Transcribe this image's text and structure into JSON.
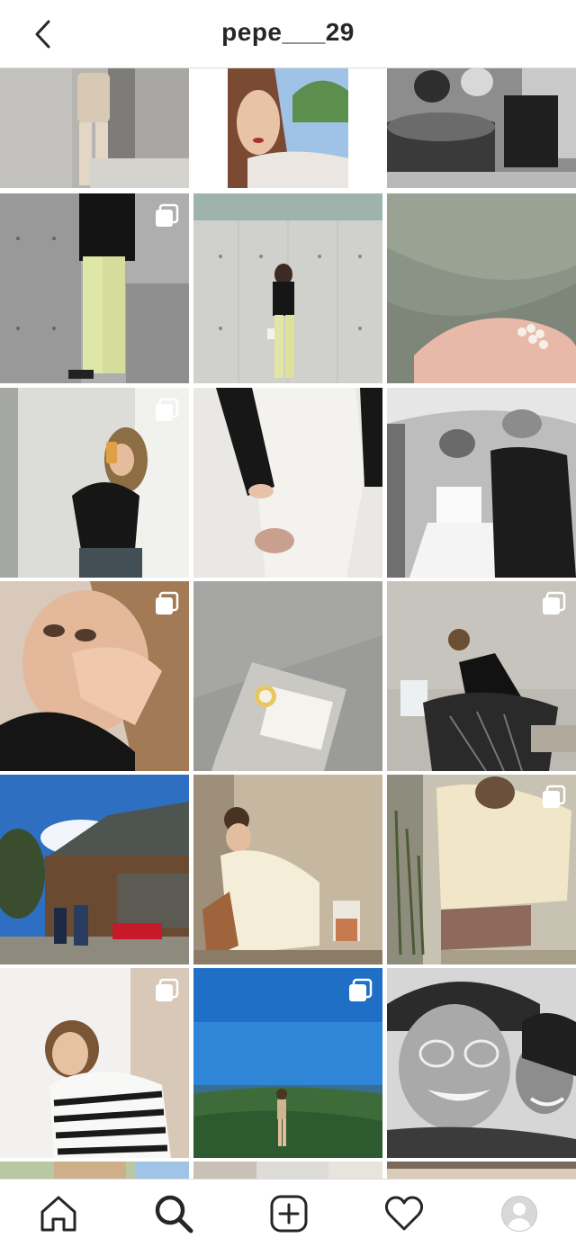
{
  "header": {
    "username": "pepe___29",
    "back_icon": "chevron-left-icon"
  },
  "grid": {
    "posts": [
      {
        "scene": "concrete-wall-beige-outfit",
        "bw": false,
        "multi": false
      },
      {
        "scene": "selfie-palm-tree",
        "bw": false,
        "multi": false
      },
      {
        "scene": "bw-grill-dinner",
        "bw": true,
        "multi": false
      },
      {
        "scene": "yellow-pants-wall",
        "bw": false,
        "multi": true
      },
      {
        "scene": "concrete-wall-standing",
        "bw": false,
        "multi": false
      },
      {
        "scene": "pearl-ring-hand",
        "bw": false,
        "multi": false
      },
      {
        "scene": "mirror-selfie-black-knit",
        "bw": false,
        "multi": true
      },
      {
        "scene": "ripped-white-jeans",
        "bw": false,
        "multi": false
      },
      {
        "scene": "bw-bridal-hairstyle",
        "bw": true,
        "multi": false
      },
      {
        "scene": "closeup-face-hand",
        "bw": false,
        "multi": true
      },
      {
        "scene": "pin-on-card",
        "bw": false,
        "multi": false
      },
      {
        "scene": "black-dress-pose",
        "bw": false,
        "multi": true
      },
      {
        "scene": "japanese-temple",
        "bw": false,
        "multi": false
      },
      {
        "scene": "sitting-cream-sweater",
        "bw": false,
        "multi": false
      },
      {
        "scene": "knit-shorts-outfit",
        "bw": false,
        "multi": true
      },
      {
        "scene": "striped-sweater",
        "bw": false,
        "multi": true
      },
      {
        "scene": "coast-view-sky",
        "bw": false,
        "multi": true
      },
      {
        "scene": "bw-friends-selfie",
        "bw": true,
        "multi": false
      },
      {
        "scene": "partial-1",
        "bw": false,
        "multi": false
      },
      {
        "scene": "partial-2",
        "bw": false,
        "multi": false
      },
      {
        "scene": "partial-3",
        "bw": false,
        "multi": false
      }
    ],
    "multi_icon": "carousel-icon"
  },
  "tabbar": {
    "tabs": [
      {
        "icon": "home-icon",
        "active": false
      },
      {
        "icon": "search-icon",
        "active": true
      },
      {
        "icon": "add-post-icon",
        "active": false
      },
      {
        "icon": "heart-icon",
        "active": false
      },
      {
        "icon": "profile-avatar-icon",
        "active": false
      }
    ]
  },
  "colors": {
    "text": "#262626",
    "divider": "#dbdbdb",
    "background": "#ffffff"
  }
}
